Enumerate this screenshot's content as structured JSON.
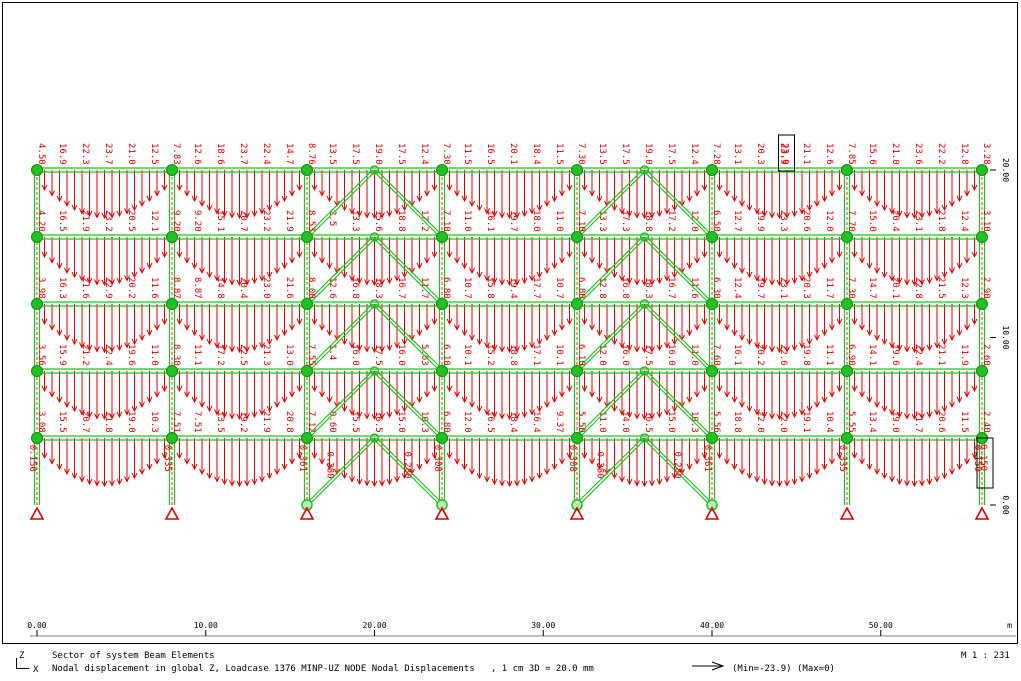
{
  "title_line": "Sector of system Beam Elements",
  "caption_line": "Nodal displacement in global Z, Loadcase 1376 MINP-UZ NODE Nodal Displacements   , 1 cm 3D = 20.0 mm",
  "scale": "M 1 : 231",
  "min_label": "(Min=-23.9)",
  "max_label": "(Max=0)",
  "axis_triad": {
    "z": "Z",
    "x": "X"
  },
  "x_axis": {
    "unit": "m",
    "ticks": [
      "0.00",
      "10.00",
      "20.00",
      "30.00",
      "40.00",
      "50.00"
    ]
  },
  "y_axis": {
    "ticks": [
      "0.00",
      "10.00",
      "20.00"
    ]
  },
  "colors": {
    "load": "#e00000",
    "structure": "#22c022",
    "support": "#e00000",
    "text": "#000000"
  },
  "columns_x_m": [
    0,
    8,
    16,
    24,
    32,
    40,
    48,
    56
  ],
  "floors_y_m": [
    4,
    8,
    12,
    16,
    20
  ],
  "bay_values": {
    "20": [
      [
        "16.9",
        "22.3",
        "23.7",
        "21.0",
        "12.5"
      ],
      [
        "12.6",
        "18.6",
        "23.7",
        "22.4",
        "14.7"
      ],
      [
        "13.5",
        "17.5",
        "19.0",
        "17.5",
        "12.4"
      ],
      [
        "11.5",
        "16.5",
        "20.1",
        "18.4",
        "11.5"
      ],
      [
        "13.5",
        "17.5",
        "19.0",
        "17.5",
        "12.4"
      ],
      [
        "13.1",
        "20.3",
        "23.9",
        "21.1",
        "12.6"
      ],
      [
        "15.6",
        "21.0",
        "23.6",
        "22.2",
        "12.8"
      ]
    ],
    "16": [
      [
        "16.5",
        "21.9",
        "23.2",
        "20.5",
        "12.1"
      ],
      [
        "9.20",
        "15.1",
        "20.7",
        "23.2",
        "21.9"
      ],
      [
        "2.5",
        "13.3",
        "15.6",
        "18.8",
        "17.2"
      ],
      [
        "11.0",
        "16.1",
        "19.7",
        "18.0",
        "11.0"
      ],
      [
        "13.3",
        "17.3",
        "18.8",
        "17.2",
        "12.0"
      ],
      [
        "12.7",
        "19.9",
        "23.3",
        "20.6",
        "12.0"
      ],
      [
        "15.0",
        "20.4",
        "23.1",
        "21.8",
        "12.4"
      ]
    ],
    "12": [
      [
        "16.3",
        "21.6",
        "22.9",
        "20.2",
        "11.6"
      ],
      [
        "8.87",
        "14.8",
        "20.4",
        "23.0",
        "21.6"
      ],
      [
        "12.6",
        "16.8",
        "18.3",
        "16.7",
        "11.7"
      ],
      [
        "10.7",
        "15.8",
        "19.4",
        "17.7",
        "10.7"
      ],
      [
        "12.8",
        "16.8",
        "18.3",
        "16.7",
        "11.6"
      ],
      [
        "12.4",
        "19.7",
        "23.1",
        "20.3",
        "11.7"
      ],
      [
        "14.7",
        "20.1",
        "22.8",
        "21.5",
        "12.3"
      ]
    ],
    "8": [
      [
        "15.9",
        "21.2",
        "22.4",
        "19.6",
        "11.0"
      ],
      [
        "11.1",
        "17.2",
        "22.5",
        "21.3",
        "13.0"
      ],
      [
        "1.4",
        "16.0",
        "17.5",
        "16.0",
        "5.63"
      ],
      [
        "10.1",
        "15.2",
        "18.8",
        "17.1",
        "10.1"
      ],
      [
        "12.0",
        "16.0",
        "17.5",
        "16.0",
        "11.0"
      ],
      [
        "16.1",
        "20.2",
        "22.6",
        "19.8",
        "11.1"
      ],
      [
        "14.1",
        "19.6",
        "22.4",
        "21.1",
        "11.9"
      ]
    ],
    "4": [
      [
        "15.5",
        "20.7",
        "21.8",
        "19.0",
        "10.3"
      ],
      [
        "7.51",
        "13.5",
        "19.2",
        "21.9",
        "20.8"
      ],
      [
        "0.60",
        "15.5",
        "16.5",
        "15.0",
        "10.3"
      ],
      [
        "12.0",
        "16.5",
        "18.4",
        "16.4",
        "9.37"
      ],
      [
        "11.0",
        "14.0",
        "16.5",
        "15.0",
        "10.3"
      ],
      [
        "18.8",
        "22.0",
        "22.0",
        "19.1",
        "10.4"
      ],
      [
        "13.4",
        "19.0",
        "21.7",
        "20.6",
        "11.5"
      ]
    ]
  },
  "node_values": {
    "20": [
      "4.50",
      "7.83",
      "8.76",
      "7.30",
      "7.30",
      "7.28",
      "7.85",
      "3.28"
    ],
    "16": [
      "4.20",
      "9.20",
      "8.53",
      "7.10",
      "7.10",
      "6.50",
      "7.70",
      "3.10"
    ],
    "12": [
      "3.98",
      "8.87",
      "8.00",
      "6.80",
      "6.80",
      "6.30",
      "7.30",
      "2.90"
    ],
    "8": [
      "3.56",
      "8.30",
      "7.55",
      "6.10",
      "6.10",
      "7.60",
      "6.90",
      "2.60"
    ],
    "4": [
      "3.08",
      "7.51",
      "7.12",
      "6.80",
      "5.50",
      "5.56",
      "5.55",
      "2.40"
    ]
  },
  "brace_values": [
    "0.280",
    "0.280",
    "0.280",
    "0.280"
  ],
  "ground_values": [
    "0.150",
    "0.335",
    "0.361",
    "0.308",
    "0.308",
    "0.361",
    "0.335",
    "0.150"
  ],
  "highlight_top": "23.9",
  "highlight_side": "0.150"
}
